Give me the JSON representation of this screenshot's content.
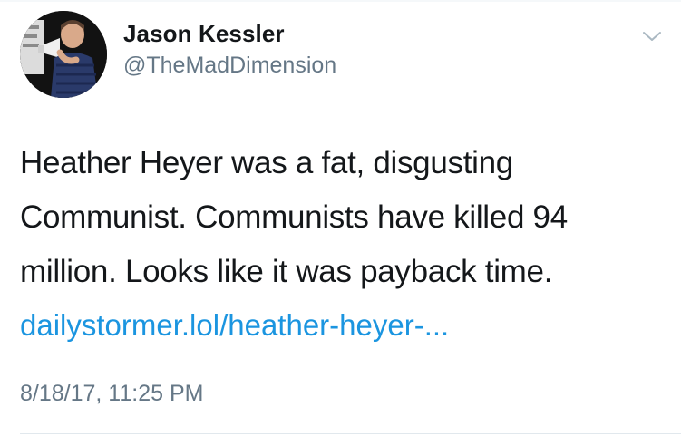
{
  "tweet": {
    "author": {
      "display_name": "Jason Kessler",
      "handle": "@TheMadDimension",
      "avatar_icon": "profile-photo"
    },
    "menu_icon": "chevron-down-icon",
    "body_lines": [
      "Heather Heyer was a fat, disgusting",
      "Communist. Communists have killed 94",
      "million. Looks like it was payback time."
    ],
    "link_text": "dailystormer.lol/heather-heyer-...",
    "timestamp": "8/18/17, 11:25 PM"
  },
  "colors": {
    "text": "#14171a",
    "secondary": "#657786",
    "link": "#1b95e0",
    "divider": "#e1e8ed"
  }
}
